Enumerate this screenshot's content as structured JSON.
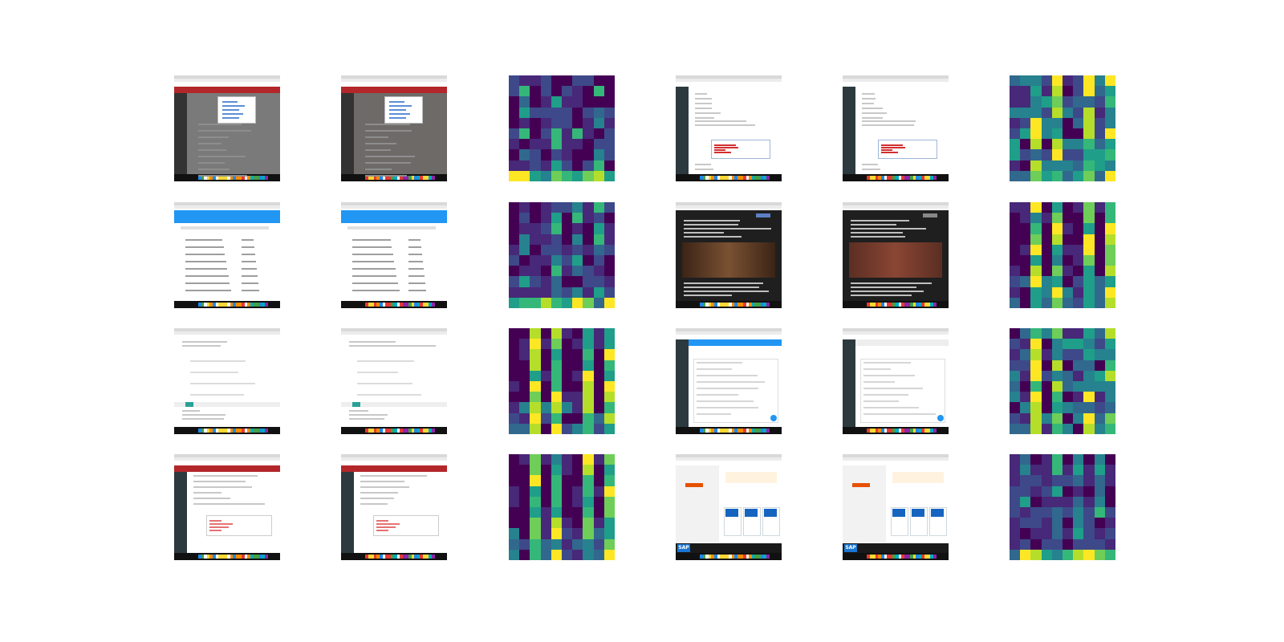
{
  "figure": {
    "rows": [
      {
        "thumbnails": [
          {
            "kind": "screenshot",
            "theme": "red-header-modal"
          },
          {
            "kind": "screenshot",
            "theme": "red-header-modal"
          },
          {
            "kind": "heatmap",
            "pattern": "sparse-columns"
          },
          {
            "kind": "screenshot",
            "theme": "dark-sidebar-form"
          },
          {
            "kind": "screenshot",
            "theme": "dark-sidebar-form"
          },
          {
            "kind": "heatmap",
            "pattern": "dense-columns"
          }
        ]
      },
      {
        "thumbnails": [
          {
            "kind": "screenshot",
            "theme": "blue-header-table"
          },
          {
            "kind": "screenshot",
            "theme": "blue-header-table"
          },
          {
            "kind": "heatmap",
            "pattern": "sparse-columns"
          },
          {
            "kind": "screenshot",
            "theme": "dark-game-article"
          },
          {
            "kind": "screenshot",
            "theme": "dark-game-article"
          },
          {
            "kind": "heatmap",
            "pattern": "bright-columns"
          }
        ]
      },
      {
        "thumbnails": [
          {
            "kind": "screenshot",
            "theme": "white-form"
          },
          {
            "kind": "screenshot",
            "theme": "white-form"
          },
          {
            "kind": "heatmap",
            "pattern": "bright-columns"
          },
          {
            "kind": "screenshot",
            "theme": "dark-sidebar-blue-header"
          },
          {
            "kind": "screenshot",
            "theme": "dark-sidebar-blue-header"
          },
          {
            "kind": "heatmap",
            "pattern": "dense-columns"
          }
        ]
      },
      {
        "thumbnails": [
          {
            "kind": "screenshot",
            "theme": "red-header-list"
          },
          {
            "kind": "screenshot",
            "theme": "red-header-list"
          },
          {
            "kind": "heatmap",
            "pattern": "bright-columns"
          },
          {
            "kind": "screenshot",
            "theme": "sap-portal"
          },
          {
            "kind": "screenshot",
            "theme": "sap-portal"
          },
          {
            "kind": "heatmap",
            "pattern": "sparse-columns"
          }
        ]
      }
    ],
    "sap_logo_text": "SAP",
    "colormap": [
      "#440154",
      "#482878",
      "#3e4989",
      "#31688e",
      "#26828e",
      "#1f9e89",
      "#35b779",
      "#6ece58",
      "#b5de2b",
      "#fde725"
    ],
    "colors": {
      "red_header": "#b3262a",
      "blue_header": "#2196f3",
      "dark_sidebar": "#2c3a3f",
      "dark_page": "#1f1f1f",
      "dock": "#111111"
    }
  }
}
